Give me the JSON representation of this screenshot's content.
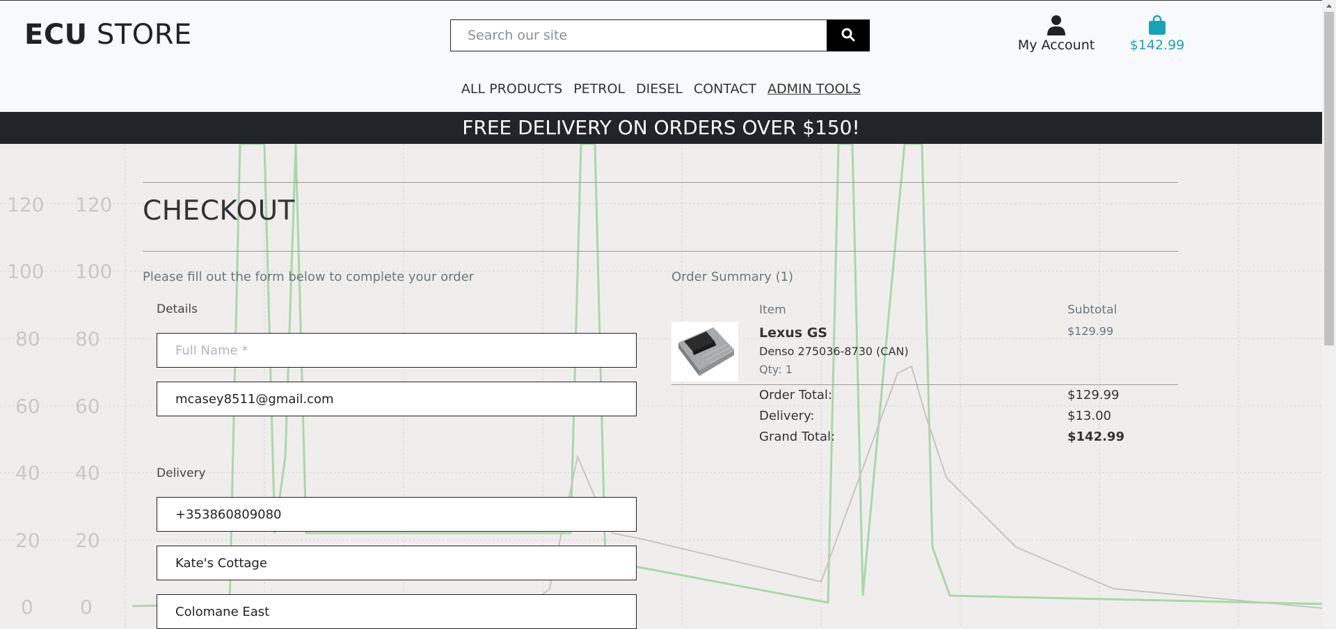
{
  "header": {
    "logo_bold": "ECU",
    "logo_light": " STORE",
    "search": {
      "placeholder": "Search our site"
    },
    "account_label": "My Account",
    "cart_total": "$142.99",
    "cart_color": "#17a2b8"
  },
  "nav": {
    "items": [
      {
        "label": "ALL PRODUCTS"
      },
      {
        "label": "PETROL"
      },
      {
        "label": "DIESEL"
      },
      {
        "label": "CONTACT"
      },
      {
        "label": "ADMIN TOOLS"
      }
    ]
  },
  "banner": {
    "text": "FREE DELIVERY ON ORDERS OVER $150!"
  },
  "background": {
    "y_ticks": [
      "120",
      "100",
      "80",
      "60",
      "40",
      "20",
      "0"
    ]
  },
  "checkout": {
    "title": "CHECKOUT",
    "instructions": "Please fill out the form below to complete your order",
    "details_label": "Details",
    "full_name": {
      "placeholder": "Full Name *",
      "value": ""
    },
    "email": {
      "value": "mcasey8511@gmail.com"
    },
    "delivery_label": "Delivery",
    "phone": {
      "value": "+353860809080"
    },
    "address1": {
      "value": "Kate's Cottage"
    },
    "address2": {
      "value": "Colomane East"
    }
  },
  "summary": {
    "title": "Order Summary (1)",
    "col_item": "Item",
    "col_subtotal": "Subtotal",
    "product": {
      "name": "Lexus GS",
      "sku": "Denso 275036-8730 (CAN)",
      "qty": "Qty: 1",
      "subtotal": "$129.99"
    },
    "order_total_label": "Order Total:",
    "order_total": "$129.99",
    "delivery_label": "Delivery:",
    "delivery": "$13.00",
    "grand_total_label": "Grand Total:",
    "grand_total": "$142.99"
  }
}
